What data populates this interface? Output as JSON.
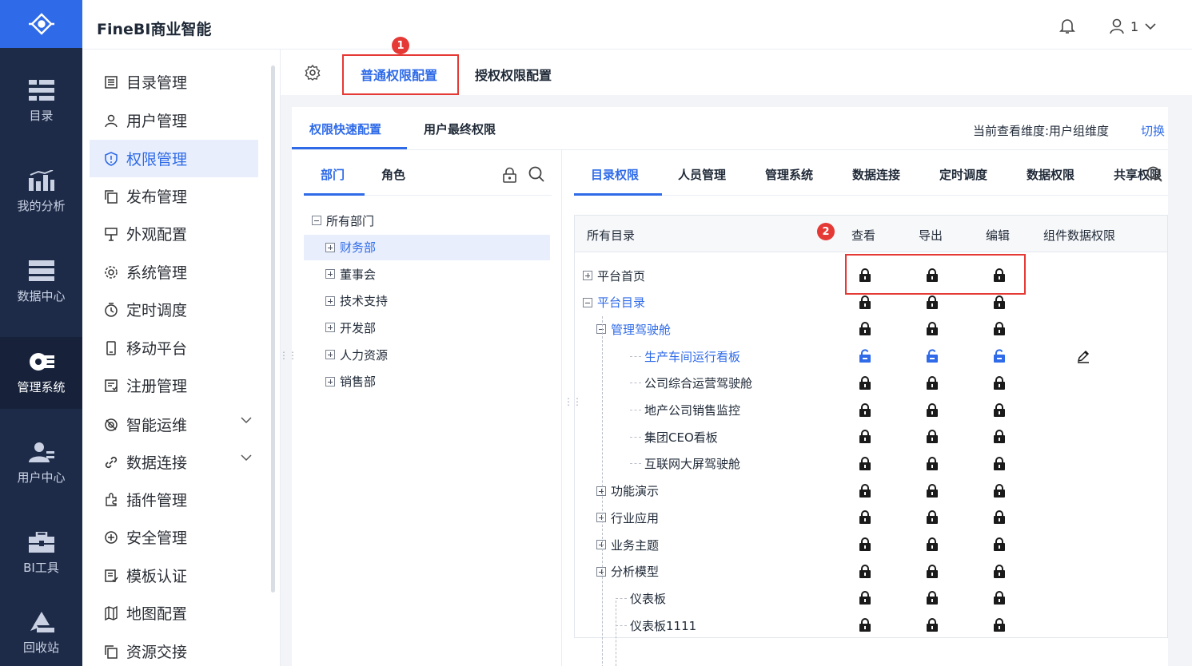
{
  "app": {
    "title": "FineBI商业智能",
    "user_name": "1"
  },
  "rail": [
    {
      "label": "目录",
      "icon": "catalog-icon"
    },
    {
      "label": "我的分析",
      "icon": "analysis-icon"
    },
    {
      "label": "数据中心",
      "icon": "data-center-icon"
    },
    {
      "label": "管理系统",
      "icon": "management-icon",
      "active": true
    },
    {
      "label": "用户中心",
      "icon": "user-center-icon"
    },
    {
      "label": "BI工具",
      "icon": "toolbox-icon"
    },
    {
      "label": "回收站",
      "icon": "recycle-icon"
    }
  ],
  "menu": [
    {
      "label": "目录管理",
      "icon": "list-icon"
    },
    {
      "label": "用户管理",
      "icon": "user-icon"
    },
    {
      "label": "权限管理",
      "icon": "shield-icon",
      "active": true
    },
    {
      "label": "发布管理",
      "icon": "copy-icon"
    },
    {
      "label": "外观配置",
      "icon": "brush-icon"
    },
    {
      "label": "系统管理",
      "icon": "gear-icon"
    },
    {
      "label": "定时调度",
      "icon": "timer-icon"
    },
    {
      "label": "移动平台",
      "icon": "mobile-icon"
    },
    {
      "label": "注册管理",
      "icon": "register-icon"
    },
    {
      "label": "智能运维",
      "icon": "ops-icon",
      "expandable": true
    },
    {
      "label": "数据连接",
      "icon": "link-icon",
      "expandable": true
    },
    {
      "label": "插件管理",
      "icon": "plugin-icon"
    },
    {
      "label": "安全管理",
      "icon": "safety-icon"
    },
    {
      "label": "模板认证",
      "icon": "template-icon"
    },
    {
      "label": "地图配置",
      "icon": "map-icon"
    },
    {
      "label": "资源交接",
      "icon": "resource-icon"
    }
  ],
  "top_tabs": {
    "normal": "普通权限配置",
    "grant": "授权权限配置"
  },
  "badges": {
    "one": "1",
    "two": "2"
  },
  "sub_tabs": {
    "quick": "权限快速配置",
    "final": "用户最终权限"
  },
  "dimension": {
    "label": "当前查看维度:用户组维度",
    "switch": "切换"
  },
  "left_tabs": {
    "dept": "部门",
    "role": "角色"
  },
  "dept_tree": [
    {
      "label": "所有部门",
      "expanded": true
    },
    {
      "label": "财务部",
      "selected": true
    },
    {
      "label": "董事会"
    },
    {
      "label": "技术支持"
    },
    {
      "label": "开发部"
    },
    {
      "label": "人力资源"
    },
    {
      "label": "销售部"
    }
  ],
  "perm_tabs": [
    "目录权限",
    "人员管理",
    "管理系统",
    "数据连接",
    "定时调度",
    "数据权限",
    "共享权限"
  ],
  "table_headers": {
    "dir": "所有目录",
    "view": "查看",
    "export": "导出",
    "edit": "编辑",
    "component": "组件数据权限"
  },
  "dir_rows": [
    {
      "label": "平台首页",
      "locks": "ccc"
    },
    {
      "label": "平台目录",
      "locks": "ccc",
      "blue": true
    },
    {
      "label": "管理驾驶舱",
      "locks": "ccc",
      "blue": true
    },
    {
      "label": "生产车间运行看板",
      "locks": "ooo",
      "blue": true,
      "edit_icon": "pencil-icon"
    },
    {
      "label": "公司综合运营驾驶舱",
      "locks": "ccc"
    },
    {
      "label": "地产公司销售监控",
      "locks": "ccc"
    },
    {
      "label": "集团CEO看板",
      "locks": "ccc"
    },
    {
      "label": "互联网大屏驾驶舱",
      "locks": "ccc"
    },
    {
      "label": "功能演示",
      "locks": "ccc"
    },
    {
      "label": "行业应用",
      "locks": "ccc"
    },
    {
      "label": "业务主题",
      "locks": "ccc"
    },
    {
      "label": "分析模型",
      "locks": "ccc"
    },
    {
      "label": "仪表板",
      "locks": "ccc"
    },
    {
      "label": "仪表板1111",
      "locks": "ccc"
    }
  ],
  "colors": {
    "accent": "#2f6be8",
    "rail": "#1e2b48",
    "highlight": "#e53935"
  }
}
